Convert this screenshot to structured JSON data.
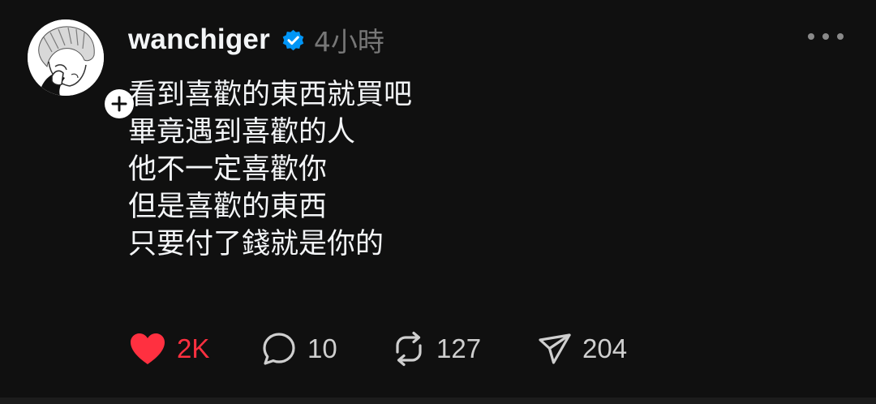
{
  "post": {
    "author": {
      "username": "wanchiger",
      "verified": true,
      "avatar_icon": "user-avatar-sketch"
    },
    "timestamp": "4小時",
    "lines": [
      "看到喜歡的東西就買吧",
      "畢竟遇到喜歡的人",
      "他不一定喜歡你",
      "但是喜歡的東西",
      "只要付了錢就是你的"
    ],
    "actions": {
      "like": {
        "count": "2K",
        "icon": "heart-icon",
        "active": true,
        "color": "#ff3040"
      },
      "reply": {
        "count": "10",
        "icon": "comment-icon"
      },
      "repost": {
        "count": "127",
        "icon": "repost-icon"
      },
      "share": {
        "count": "204",
        "icon": "send-icon"
      }
    }
  },
  "colors": {
    "background": "#101010",
    "text": "#f3f5f7",
    "muted": "#777777",
    "verified_blue": "#0095f6",
    "like_red": "#ff3040"
  }
}
